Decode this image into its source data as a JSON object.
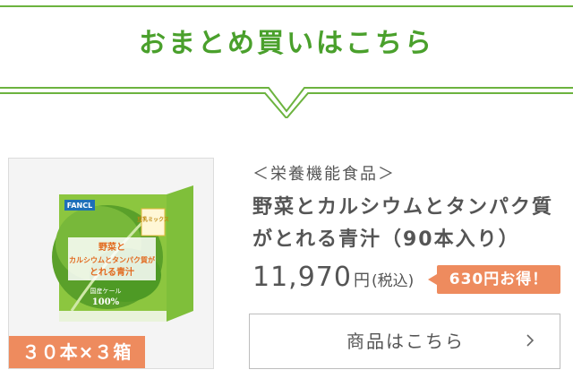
{
  "header": {
    "title": "おまとめ買いはこちら"
  },
  "product": {
    "image": {
      "brand_logo": "FANCL",
      "box_tag": "豆乳ミックス",
      "box_text_line1": "野菜と",
      "box_text_line2": "カルシウムとタンパク質が",
      "box_text_line3": "とれる青汁",
      "box_text_line4": "国産ケール",
      "box_text_line5": "100%"
    },
    "quantity_badge": "３０本×３箱",
    "category": "＜栄養機能食品＞",
    "title": "野菜とカルシウムとタンパク質がとれる青汁（90本入り）",
    "price": "11,970",
    "price_unit": "円",
    "tax_note": "(税込)",
    "discount_badge": "630円お得！",
    "cta_label": "商品はこちら"
  },
  "colors": {
    "brand_green": "#4aa02c",
    "accent_orange": "#ee8b5e"
  },
  "icons": {
    "cta_arrow": "chevron-right-icon"
  }
}
